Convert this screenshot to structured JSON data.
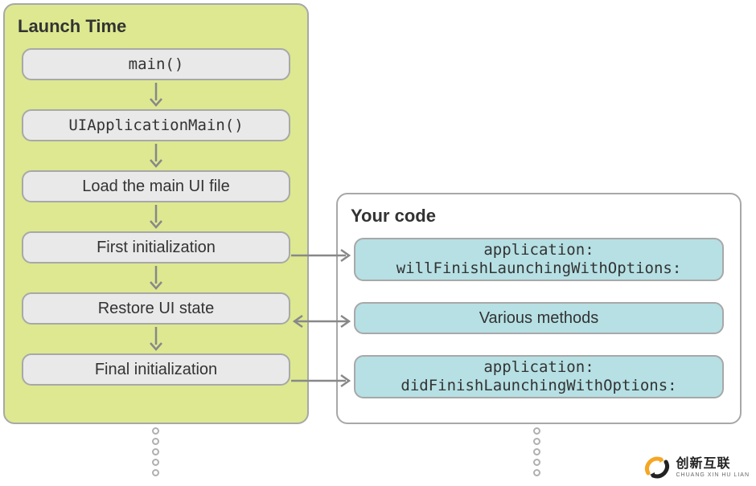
{
  "launch_panel": {
    "title": "Launch Time",
    "steps": [
      {
        "label": "main()",
        "mono": true
      },
      {
        "label": "UIApplicationMain()",
        "mono": true
      },
      {
        "label": "Load the main UI file",
        "mono": false
      },
      {
        "label": "First initialization",
        "mono": false
      },
      {
        "label": "Restore UI state",
        "mono": false
      },
      {
        "label": "Final initialization",
        "mono": false
      }
    ]
  },
  "code_panel": {
    "title": "Your code",
    "items": [
      {
        "line1": "application:",
        "line2": "willFinishLaunchingWithOptions:"
      },
      {
        "line1": "Various methods",
        "line2": ""
      },
      {
        "line1": "application:",
        "line2": "didFinishLaunchingWithOptions:"
      }
    ]
  },
  "connections": [
    {
      "from": "first-initialization",
      "to": "will-finish",
      "bidirectional": false
    },
    {
      "from": "restore-ui-state",
      "to": "various-methods",
      "bidirectional": true
    },
    {
      "from": "final-initialization",
      "to": "did-finish",
      "bidirectional": false
    }
  ],
  "logo": {
    "text_main": "创新互联",
    "text_sub": "CHUANG XIN HU LIAN"
  },
  "colors": {
    "launch_bg": "#dde890",
    "code_node_bg": "#b6e0e4",
    "node_bg": "#e9e9e9",
    "border": "#a8a8a8"
  }
}
